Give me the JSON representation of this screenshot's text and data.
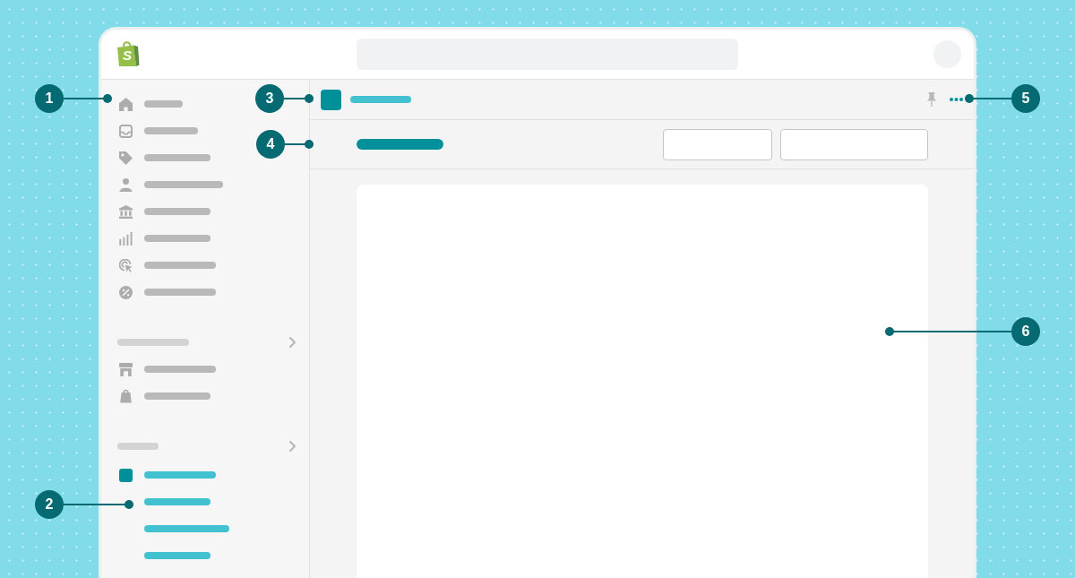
{
  "top_bar": {
    "logo": {
      "letter": "S"
    }
  },
  "sidebar": {
    "items": [
      {
        "kind": "link"
      },
      {
        "kind": "link"
      },
      {
        "kind": "link"
      },
      {
        "kind": "link"
      },
      {
        "kind": "link"
      },
      {
        "kind": "link"
      },
      {
        "kind": "link"
      },
      {
        "kind": "link"
      },
      {
        "kind": "section"
      },
      {
        "kind": "link"
      },
      {
        "kind": "link"
      },
      {
        "kind": "section"
      },
      {
        "kind": "app"
      },
      {
        "kind": "app-link"
      },
      {
        "kind": "app-link"
      },
      {
        "kind": "app-link"
      }
    ]
  },
  "callouts": [
    {
      "label": "1"
    },
    {
      "label": "2"
    },
    {
      "label": "3"
    },
    {
      "label": "4"
    },
    {
      "label": "5"
    },
    {
      "label": "6"
    }
  ]
}
